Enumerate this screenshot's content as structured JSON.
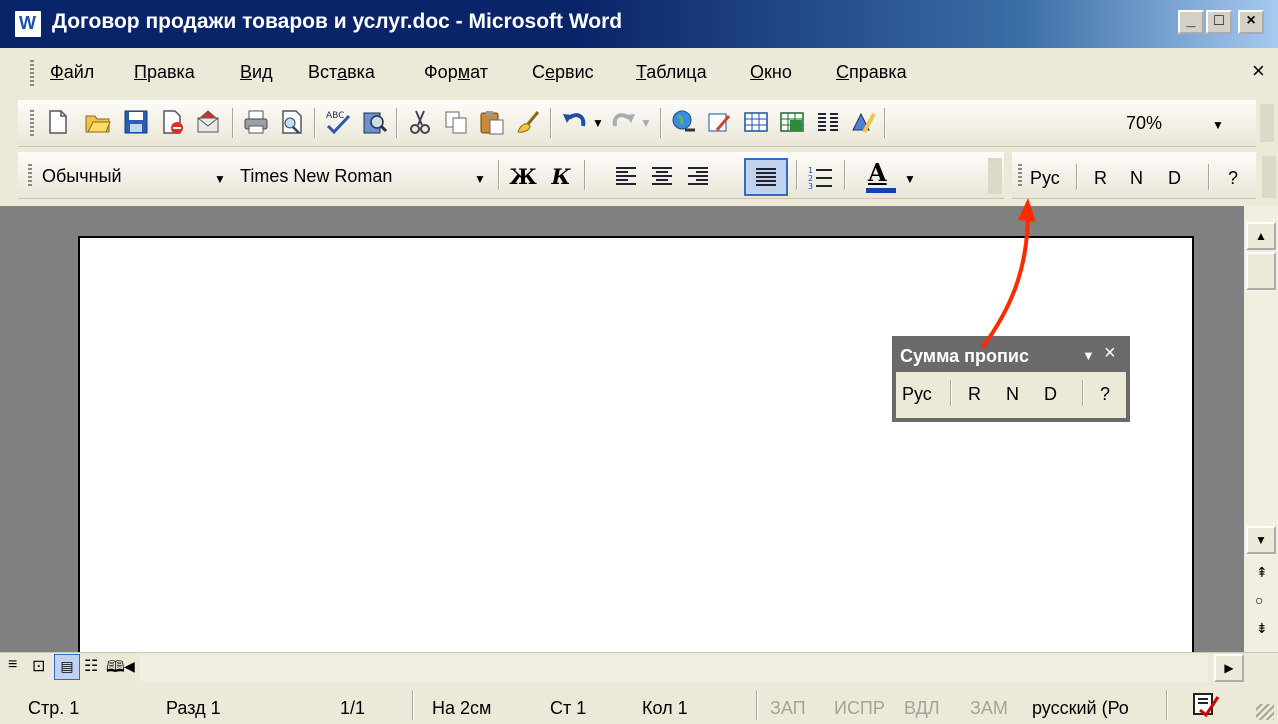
{
  "window": {
    "title": "Договор продажи товаров и услуг.doc - Microsoft Word",
    "minimize": "_",
    "maximize": "□",
    "close": "×"
  },
  "menu": {
    "items": [
      {
        "pre": "",
        "ul": "Ф",
        "post": "айл"
      },
      {
        "pre": "",
        "ul": "П",
        "post": "равка"
      },
      {
        "pre": "",
        "ul": "В",
        "post": "ид"
      },
      {
        "pre": "Вст",
        "ul": "а",
        "post": "вка"
      },
      {
        "pre": "Фор",
        "ul": "м",
        "post": "ат"
      },
      {
        "pre": "С",
        "ul": "е",
        "post": "рвис"
      },
      {
        "pre": "",
        "ul": "Т",
        "post": "аблица"
      },
      {
        "pre": "",
        "ul": "О",
        "post": "кно"
      },
      {
        "pre": "",
        "ul": "С",
        "post": "правка"
      }
    ],
    "close": "×"
  },
  "standard_toolbar": {
    "zoom": "70%"
  },
  "formatting_toolbar": {
    "style": "Обычный",
    "font": "Times New Roman",
    "bold": "Ж",
    "italic": "К",
    "font_color_letter": "A"
  },
  "custom_toolbar": {
    "rus": "Рус",
    "r": "R",
    "n": "N",
    "d": "D",
    "help": "?"
  },
  "floating_toolbar": {
    "title": "Сумма пропис",
    "rus": "Рус",
    "r": "R",
    "n": "N",
    "d": "D",
    "help": "?"
  },
  "status_bar": {
    "page": "Стр. 1",
    "section": "Разд 1",
    "pages": "1/1",
    "at": "На 2см",
    "line": "Ст 1",
    "col": "Кол 1",
    "rec": "ЗАП",
    "trk": "ИСПР",
    "ext": "ВДЛ",
    "ovr": "ЗАМ",
    "language": "русский (Ро"
  },
  "colors": {
    "title_bar": "#0a246a",
    "arrow": "#ff2a00",
    "document_background": "#808080"
  }
}
